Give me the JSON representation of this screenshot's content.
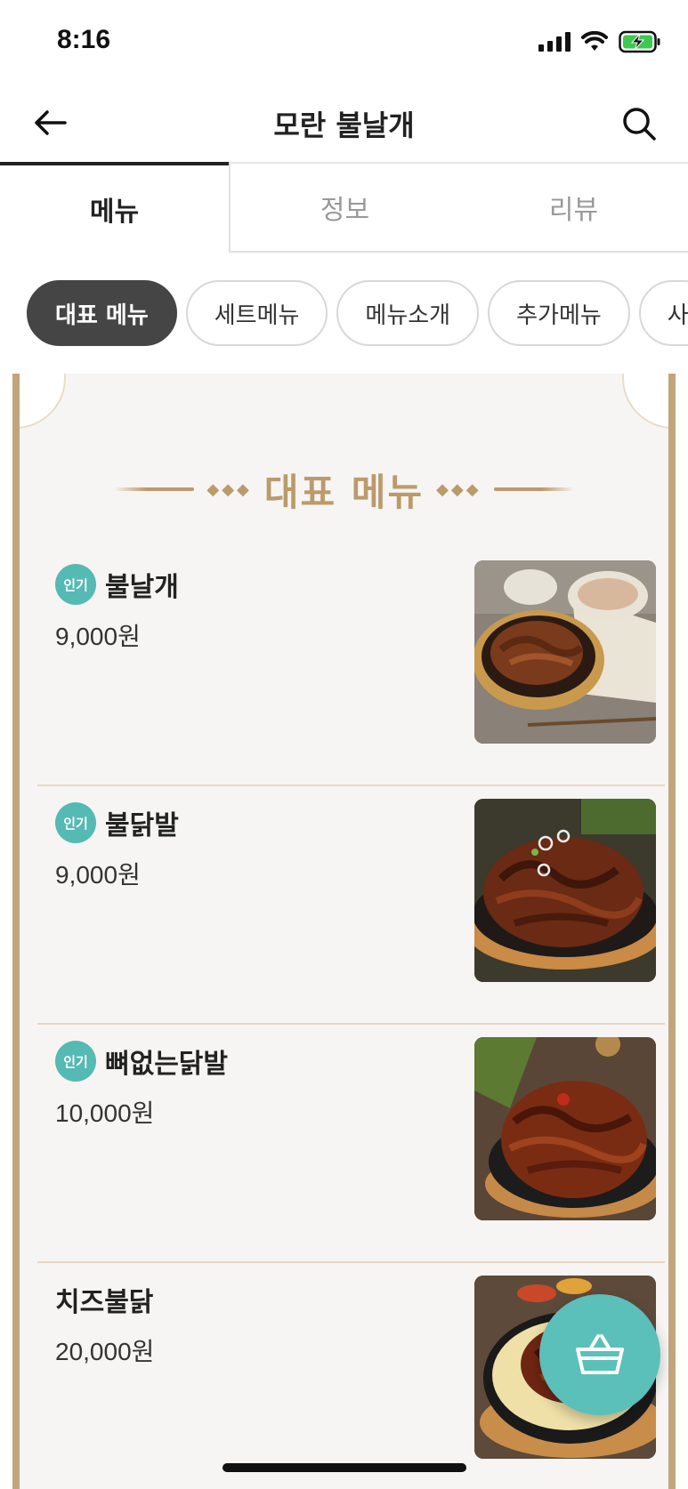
{
  "status": {
    "time": "8:16"
  },
  "header": {
    "title": "모란 불날개"
  },
  "tabs": [
    {
      "label": "메뉴"
    },
    {
      "label": "정보"
    },
    {
      "label": "리뷰"
    }
  ],
  "categories": [
    {
      "label": "대표 메뉴"
    },
    {
      "label": "세트메뉴"
    },
    {
      "label": "메뉴소개"
    },
    {
      "label": "추가메뉴"
    },
    {
      "label": "사"
    }
  ],
  "section": {
    "title": "대표 메뉴"
  },
  "menu": [
    {
      "badge": "인기",
      "name": "불날개",
      "price": "9,000원"
    },
    {
      "badge": "인기",
      "name": "불닭발",
      "price": "9,000원"
    },
    {
      "badge": "인기",
      "name": "뼈없는닭발",
      "price": "10,000원"
    },
    {
      "name": "치즈불닭",
      "price": "20,000원"
    }
  ],
  "colors": {
    "accent": "#5bbfba",
    "board_border": "#c2a57d",
    "section_title": "#bb9a6c",
    "active_chip": "#454545"
  },
  "icons": {
    "back": "arrow-left-icon",
    "search": "search-icon",
    "cart": "basket-icon"
  }
}
